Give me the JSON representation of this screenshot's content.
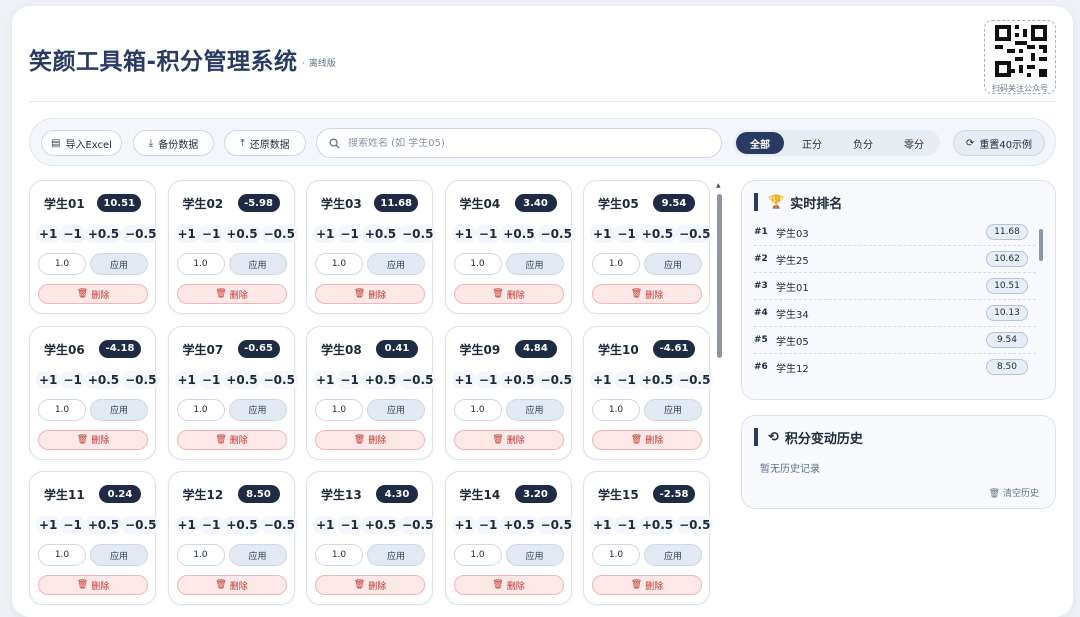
{
  "header": {
    "title": "笑颜工具箱-积分管理系统",
    "subtitle": "离线版",
    "qr_caption": "扫码关注公众号"
  },
  "toolbar": {
    "import_label": "导入Excel",
    "backup_label": "备份数据",
    "restore_label": "还原数据",
    "search_placeholder": "搜索姓名 (如 学生05)",
    "filters": [
      "全部",
      "正分",
      "负分",
      "零分"
    ],
    "active_filter": "全部",
    "reset_label": "重置40示例"
  },
  "card_labels": {
    "adjustments": [
      "+1",
      "−1",
      "+0.5",
      "−0.5"
    ],
    "default_value": "1.0",
    "apply": "应用",
    "delete": "删除"
  },
  "students": [
    {
      "name": "学生01",
      "score": "10.51"
    },
    {
      "name": "学生02",
      "score": "-5.98"
    },
    {
      "name": "学生03",
      "score": "11.68"
    },
    {
      "name": "学生04",
      "score": "3.40"
    },
    {
      "name": "学生05",
      "score": "9.54"
    },
    {
      "name": "学生06",
      "score": "-4.18"
    },
    {
      "name": "学生07",
      "score": "-0.65"
    },
    {
      "name": "学生08",
      "score": "0.41"
    },
    {
      "name": "学生09",
      "score": "4.84"
    },
    {
      "name": "学生10",
      "score": "-4.61"
    },
    {
      "name": "学生11",
      "score": "0.24"
    },
    {
      "name": "学生12",
      "score": "8.50"
    },
    {
      "name": "学生13",
      "score": "4.30"
    },
    {
      "name": "学生14",
      "score": "3.20"
    },
    {
      "name": "学生15",
      "score": "-2.58"
    }
  ],
  "ranking": {
    "title": "实时排名",
    "rows": [
      {
        "rank": "#1",
        "name": "学生03",
        "score": "11.68"
      },
      {
        "rank": "#2",
        "name": "学生25",
        "score": "10.62"
      },
      {
        "rank": "#3",
        "name": "学生01",
        "score": "10.51"
      },
      {
        "rank": "#4",
        "name": "学生34",
        "score": "10.13"
      },
      {
        "rank": "#5",
        "name": "学生05",
        "score": "9.54"
      },
      {
        "rank": "#6",
        "name": "学生12",
        "score": "8.50"
      }
    ]
  },
  "history": {
    "title": "积分变动历史",
    "empty_text": "暂无历史记录",
    "clear_label": "清空历史"
  }
}
